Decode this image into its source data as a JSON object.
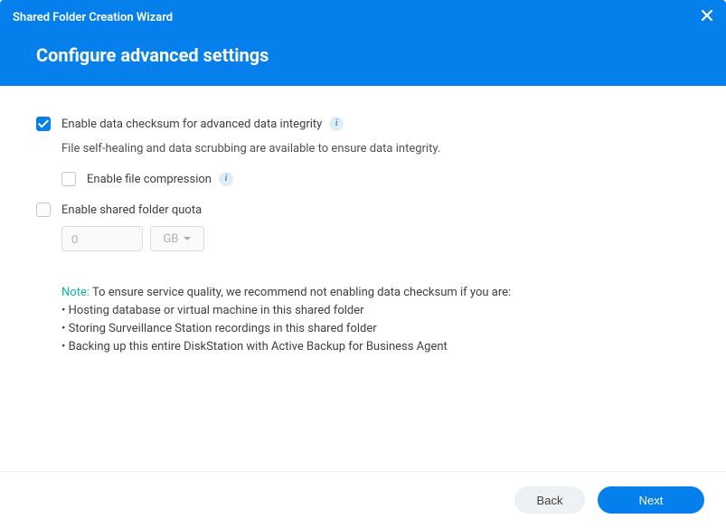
{
  "window": {
    "title": "Shared Folder Creation Wizard"
  },
  "page": {
    "title": "Configure advanced settings"
  },
  "options": {
    "checksum": {
      "label": "Enable data checksum for advanced data integrity",
      "description": "File self-healing and data scrubbing are available to ensure data integrity.",
      "checked": true
    },
    "compression": {
      "label": "Enable file compression",
      "checked": false
    },
    "quota": {
      "label": "Enable shared folder quota",
      "checked": false,
      "value_placeholder": "0",
      "unit": "GB"
    }
  },
  "note": {
    "label": "Note:",
    "intro": " To ensure service quality, we recommend not enabling data checksum if you are:",
    "items": [
      "• Hosting database or virtual machine in this shared folder",
      "• Storing Surveillance Station recordings in this shared folder",
      "• Backing up this entire DiskStation with Active Backup for Business Agent"
    ]
  },
  "footer": {
    "back": "Back",
    "next": "Next"
  }
}
